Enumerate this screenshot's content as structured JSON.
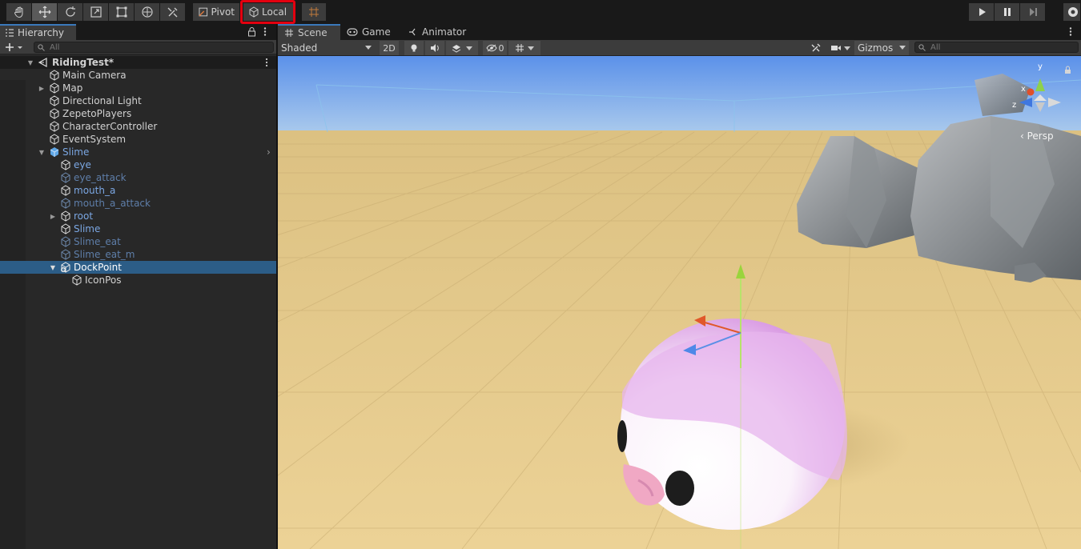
{
  "toolbar": {
    "tools": [
      "hand-tool",
      "move-tool",
      "rotate-tool",
      "scale-tool",
      "rect-tool",
      "transform-tool",
      "custom-tool"
    ],
    "pivot_label": "Pivot",
    "local_label": "Local",
    "play_controls": [
      "play",
      "pause",
      "step"
    ]
  },
  "hierarchy": {
    "tab_label": "Hierarchy",
    "search_placeholder": "All",
    "scene_name": "RidingTest*",
    "items": [
      {
        "label": "Main Camera"
      },
      {
        "label": "Map"
      },
      {
        "label": "Directional Light"
      },
      {
        "label": "ZepetoPlayers"
      },
      {
        "label": "CharacterController"
      },
      {
        "label": "EventSystem"
      },
      {
        "label": "Slime"
      },
      {
        "label": "eye"
      },
      {
        "label": "eye_attack"
      },
      {
        "label": "mouth_a"
      },
      {
        "label": "mouth_a_attack"
      },
      {
        "label": "root"
      },
      {
        "label": "Slime"
      },
      {
        "label": "Slime_eat"
      },
      {
        "label": "Slime_eat_m"
      },
      {
        "label": "DockPoint"
      },
      {
        "label": "IconPos"
      }
    ]
  },
  "scene": {
    "tabs": [
      "Scene",
      "Game",
      "Animator"
    ],
    "shading_mode": "Shaded",
    "mode_2d": "2D",
    "hidden_count": "0",
    "gizmos_label": "Gizmos",
    "search_placeholder": "All",
    "projection_label": "‹ Persp",
    "axis_labels": {
      "x": "x",
      "y": "y",
      "z": "z"
    }
  },
  "colors": {
    "accent": "#3a79bb",
    "selection": "#2c5d87",
    "highlight_border": "#e3000f",
    "sky": "#6f9fe6",
    "ground": "#e6c98e"
  }
}
